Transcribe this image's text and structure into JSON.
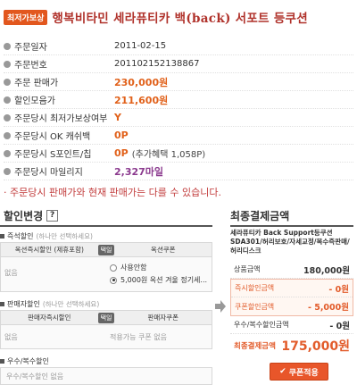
{
  "header": {
    "badge": "최저가보상",
    "product_title": "행복비타민 세라퓨티카 백(back) 서포트 등쿠션"
  },
  "order_info": [
    {
      "label": "주문일자",
      "value": "2011-02-15",
      "style": "plain"
    },
    {
      "label": "주문번호",
      "value": "201102152138867",
      "style": "plain"
    },
    {
      "label": "주문 판매가",
      "value": "230,000원",
      "style": "orange"
    },
    {
      "label": "할인모음가",
      "value": "211,600원",
      "style": "orange"
    },
    {
      "label": "주문당시 최저가보상여부",
      "value": "Y",
      "style": "bold-orange"
    },
    {
      "label": "주문당시 OK 캐쉬백",
      "value": "0P",
      "style": "bold-orange"
    },
    {
      "label": "주문당시 S포인트/칩",
      "value": "0P",
      "style": "bold-orange",
      "extra": "(추가혜택 1,058P)"
    },
    {
      "label": "주문당시 마일리지",
      "value": "2,327마일",
      "style": "purple"
    }
  ],
  "notice": "· 주문당시 판매가와 현재 판매가는 다를 수 있습니다.",
  "discount_change": {
    "title": "할인변경",
    "help": "?",
    "instant_discount": {
      "label": "즉석할인",
      "sub": "(하나만 선택하세요)",
      "col_left": "옥션즉시할인 (제휴포함)",
      "col_mid": "택일",
      "col_right": "옥션쿠폰",
      "left_value": "없음",
      "options": [
        {
          "label": "사용안함",
          "checked": false
        },
        {
          "label": "5,000원 옥션 겨울 정기세...",
          "checked": true
        }
      ]
    },
    "seller_discount": {
      "label": "판매자할인",
      "sub": "(하나만 선택하세요)",
      "col_left": "판매자즉시할인",
      "col_mid": "택일",
      "col_right": "판매자쿠폰",
      "left_value": "없음",
      "right_value": "적용가능 쿠폰 없음"
    },
    "combo_discount": {
      "label": "우수/복수할인",
      "value": "우수/복수할인 없음"
    }
  },
  "final_payment": {
    "title": "최종결제금액",
    "product_desc": "세라퓨티카 Back Support등쿠션 SDA301/허리보호/자세교정/복수즉판매/허리디스크",
    "rows": [
      {
        "label": "상품금액",
        "value": "180,000원"
      },
      {
        "label": "즉시할인금액",
        "value": "- 0원"
      },
      {
        "label": "쿠폰할인금액",
        "value": "- 5,000원"
      },
      {
        "label": "우수/복수할인금액",
        "value": "- 0원"
      }
    ],
    "final_label": "최종결제금액",
    "final_value": "175,000원",
    "apply_button": "쿠폰적용"
  },
  "colors": {
    "accent": "#e8562a",
    "title": "#b0322b",
    "notice": "#c23c3c"
  }
}
